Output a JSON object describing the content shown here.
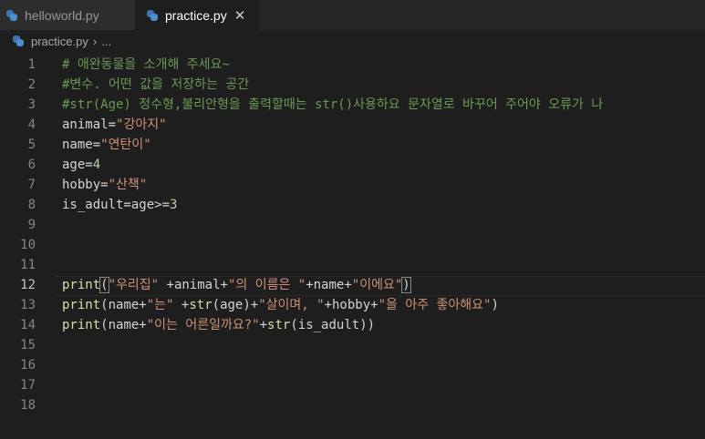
{
  "tabs": [
    {
      "label": "helloworld.py",
      "active": false
    },
    {
      "label": "practice.py",
      "active": true,
      "close": "✕"
    }
  ],
  "breadcrumb": {
    "file": "practice.py",
    "chevron": "›",
    "rest": "..."
  },
  "lines": [
    {
      "n": "1",
      "t": "# 애완동물을 소개해 주세요~"
    },
    {
      "n": "2",
      "t": "#변수. 어떤 값을 저장하는 공간"
    },
    {
      "n": "3",
      "t": "#str(Age) 정수형,불리안형을 출력할때는 str()사용하요 문자열로 바꾸어 주어야 오류가 나"
    },
    {
      "n": "4",
      "a": "animal=",
      "b": "\"강아지\""
    },
    {
      "n": "5",
      "a": "name=",
      "b": "\"연탄이\""
    },
    {
      "n": "6",
      "a": "age=",
      "b": "4"
    },
    {
      "n": "7",
      "a": "hobby=",
      "b": "\"산책\""
    },
    {
      "n": "8",
      "a": "is_adult=age>=",
      "b": "3"
    },
    {
      "n": "9"
    },
    {
      "n": "10"
    },
    {
      "n": "11"
    },
    {
      "n": "12",
      "p1": "print",
      "p2": "(",
      "p3": "\"우리집\"",
      "p4": " +animal+",
      "p5": "\"의 이름은 \"",
      "p6": "+name+",
      "p7": "\"이에요\"",
      "p8": ")"
    },
    {
      "n": "13",
      "q1": "print",
      "q2": "(name+",
      "q3": "\"는\"",
      "q4": " +",
      "q5": "str",
      "q6": "(age)+",
      "q7": "\"살이며, \"",
      "q8": "+hobby+",
      "q9": "\"을 아주 좋아해요\"",
      "q10": ")"
    },
    {
      "n": "14",
      "r1": "print",
      "r2": "(name+",
      "r3": "\"이는 어른일까요?\"",
      "r4": "+",
      "r5": "str",
      "r6": "(is_adult))"
    },
    {
      "n": "15"
    },
    {
      "n": "16"
    },
    {
      "n": "17"
    },
    {
      "n": "18"
    }
  ],
  "colors": {
    "background": "#1e1e1e",
    "comment": "#6a9955",
    "string": "#ce9178",
    "number": "#b5cea8",
    "function": "#dcdcaa"
  }
}
